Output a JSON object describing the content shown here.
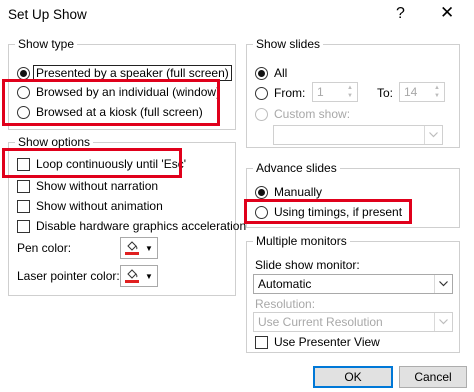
{
  "window": {
    "title": "Set Up Show",
    "help_glyph": "?",
    "close_glyph": "✕"
  },
  "show_type": {
    "label": "Show type",
    "options": [
      {
        "label": "Presented by a speaker (full screen)",
        "selected": true
      },
      {
        "label": "Browsed by an individual (window)",
        "selected": false
      },
      {
        "label": "Browsed at a kiosk (full screen)",
        "selected": false
      }
    ]
  },
  "show_options": {
    "label": "Show options",
    "checkboxes": [
      {
        "label": "Loop continuously until 'Esc'",
        "checked": false
      },
      {
        "label": "Show without narration",
        "checked": false
      },
      {
        "label": "Show without animation",
        "checked": false
      },
      {
        "label": "Disable hardware graphics acceleration",
        "checked": false
      }
    ],
    "pen_color_label": "Pen color:",
    "laser_color_label": "Laser pointer color:",
    "pen_color": "#e02020",
    "laser_color": "#e02020"
  },
  "show_slides": {
    "label": "Show slides",
    "all_label": "All",
    "from_label": "From:",
    "from_value": "1",
    "to_label": "To:",
    "to_value": "14",
    "custom_label": "Custom show:",
    "custom_value": ""
  },
  "advance_slides": {
    "label": "Advance slides",
    "manually_label": "Manually",
    "timings_label": "Using timings, if present"
  },
  "monitors": {
    "label": "Multiple monitors",
    "monitor_label": "Slide show monitor:",
    "monitor_value": "Automatic",
    "resolution_label": "Resolution:",
    "resolution_value": "Use Current Resolution",
    "presenter_view_label": "Use Presenter View",
    "presenter_view_checked": false
  },
  "buttons": {
    "ok": "OK",
    "cancel": "Cancel"
  },
  "annotations": {
    "highlight_color": "#e0001b"
  }
}
